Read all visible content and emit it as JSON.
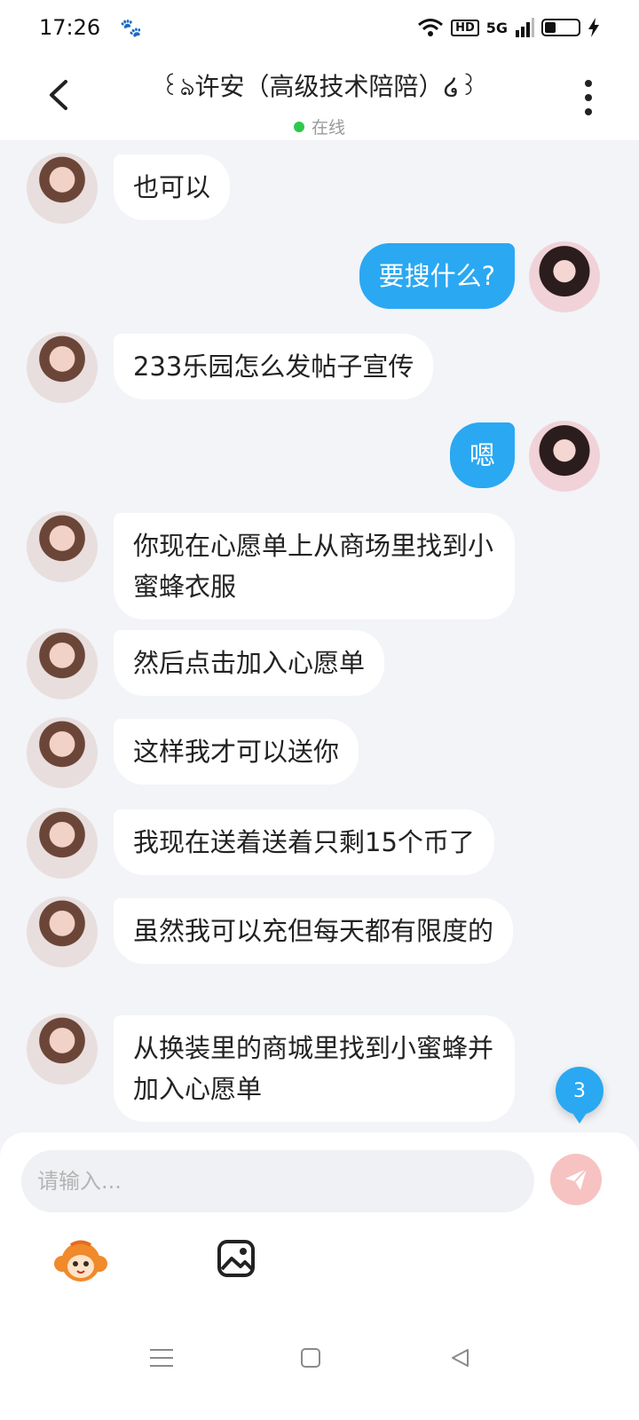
{
  "status_bar": {
    "time": "17:26",
    "network": "5G",
    "hd": "HD"
  },
  "header": {
    "title": "꒰ঌ许安（高级技术陪陪）໒꒱",
    "status": "在线"
  },
  "messages": [
    {
      "side": "left",
      "text": "也可以"
    },
    {
      "side": "right",
      "text": "要搜什么?"
    },
    {
      "side": "left",
      "text": "233乐园怎么发帖子宣传"
    },
    {
      "side": "right",
      "text": "嗯"
    },
    {
      "side": "left",
      "text": "你现在心愿单上从商场里找到小蜜蜂衣服"
    },
    {
      "side": "left",
      "text": "然后点击加入心愿单"
    },
    {
      "side": "left",
      "text": "这样我才可以送你"
    },
    {
      "side": "left",
      "text": "我现在送着送着只剩15个币了"
    },
    {
      "side": "left",
      "text": "虽然我可以充但每天都有限度的"
    },
    {
      "side": "left",
      "text": "从换装里的商城里找到小蜜蜂并加入心愿单"
    }
  ],
  "unread_count": "3",
  "composer": {
    "placeholder": "请输入..."
  },
  "colors": {
    "accent": "#2aa8f2",
    "online": "#2ec84b",
    "send_button": "#f7c2c2",
    "background": "#f2f4f7"
  },
  "icons": [
    "back-arrow-icon",
    "more-dots-icon",
    "send-icon",
    "mascot-icon",
    "image-icon",
    "menu-icon",
    "home-icon",
    "back-triangle-icon"
  ]
}
